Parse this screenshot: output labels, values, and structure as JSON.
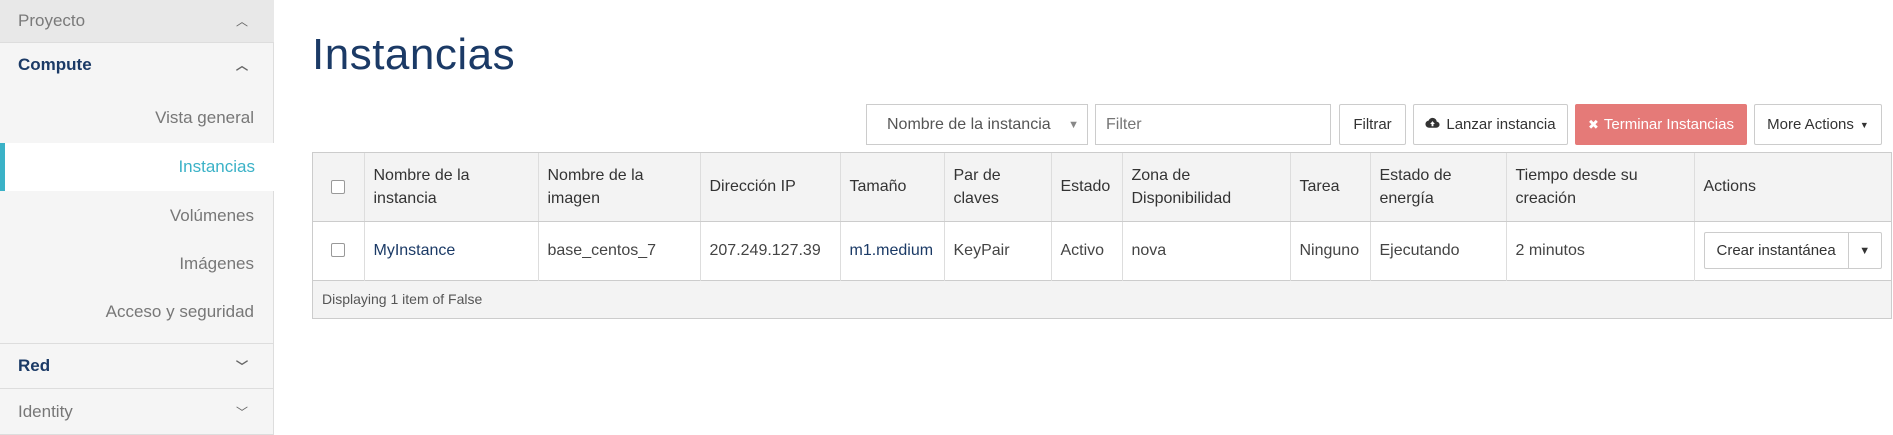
{
  "sidebar": {
    "project_label": "Proyecto",
    "compute_label": "Compute",
    "items": [
      {
        "label": "Vista general"
      },
      {
        "label": "Instancias"
      },
      {
        "label": "Volúmenes"
      },
      {
        "label": "Imágenes"
      },
      {
        "label": "Acceso y seguridad"
      }
    ],
    "red_label": "Red",
    "identity_label": "Identity"
  },
  "page": {
    "title": "Instancias"
  },
  "toolbar": {
    "filter_select_value": "Nombre de la instancia",
    "filter_placeholder": "Filter",
    "filter_button": "Filtrar",
    "launch_button": "Lanzar instancia",
    "terminate_button": "Terminar Instancias",
    "more_actions_button": "More Actions"
  },
  "table": {
    "headers": {
      "name": "Nombre de la instancia",
      "image": "Nombre de la imagen",
      "ip": "Dirección IP",
      "size": "Tamaño",
      "keypair": "Par de claves",
      "status": "Estado",
      "az": "Zona de Disponibilidad",
      "task": "Tarea",
      "power": "Estado de energía",
      "age": "Tiempo desde su creación",
      "actions": "Actions"
    },
    "rows": [
      {
        "name": "MyInstance",
        "image": "base_centos_7",
        "ip": "207.249.127.39",
        "size": "m1.medium",
        "keypair": "KeyPair",
        "status": "Activo",
        "az": "nova",
        "task": "Ninguno",
        "power": "Ejecutando",
        "age": "2 minutos",
        "action": "Crear instantánea"
      }
    ],
    "footer": "Displaying 1 item of False"
  },
  "colors": {
    "accent": "#3bb2c7",
    "title": "#1b3a66",
    "danger": "#e57a78"
  },
  "icons": {
    "launch": "cloud-upload-icon",
    "terminate": "close-icon",
    "caret": "caret-down-icon"
  }
}
